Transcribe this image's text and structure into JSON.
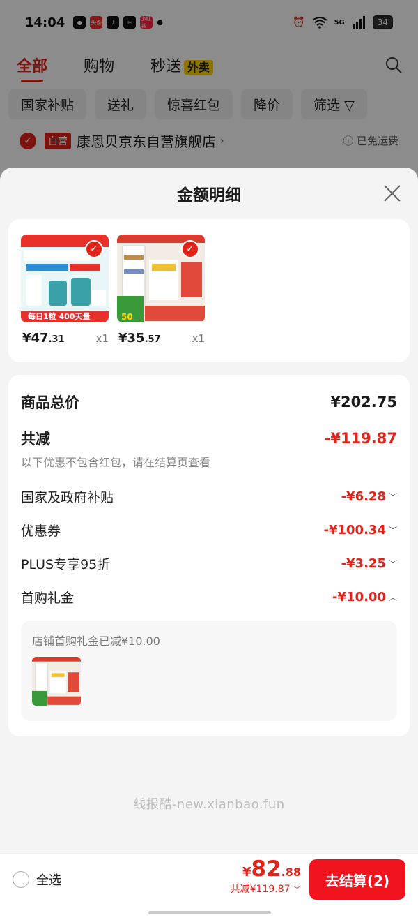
{
  "status_bar": {
    "time": "14:04",
    "app_toutiao": "头条",
    "app_xiaohongshu": "小红书",
    "network": "5G",
    "battery": "34"
  },
  "top_tabs": {
    "all": "全部",
    "shopping": "购物",
    "flash": "秒送",
    "waimai": "外卖"
  },
  "filters": [
    "国家补贴",
    "送礼",
    "惊喜红包",
    "降价",
    "筛选"
  ],
  "store": {
    "self_tag": "自营",
    "name": "康恩贝京东自营旗舰店",
    "shipping": "已免运费"
  },
  "sheet": {
    "title": "金额明细",
    "products": [
      {
        "price_int": "¥47",
        "price_dec": ".31",
        "qty": "x1"
      },
      {
        "price_int": "¥35",
        "price_dec": ".57",
        "qty": "x1"
      }
    ],
    "total_label": "商品总价",
    "total_value": "¥202.75",
    "reduce_label": "共减",
    "reduce_value": "-¥119.87",
    "reduce_note": "以下优惠不包含红包，请在结算页查看",
    "discounts": [
      {
        "label": "国家及政府补贴",
        "value": "-¥6.28",
        "expanded": false
      },
      {
        "label": "优惠券",
        "value": "-¥100.34",
        "expanded": false
      },
      {
        "label": "PLUS专享95折",
        "value": "-¥3.25",
        "expanded": false
      },
      {
        "label": "首购礼金",
        "value": "-¥10.00",
        "expanded": true
      }
    ],
    "gift_note": "店铺首购礼金已减¥10.00"
  },
  "watermark": "线报酷-new.xianbao.fun",
  "bottom_bar": {
    "select_all": "全选",
    "total_yen": "¥",
    "total_int": "82",
    "total_dec": ".88",
    "total_reduce": "共减¥119.87",
    "checkout": "去结算(2)"
  },
  "colors": {
    "accent": "#e2231a",
    "checkout": "#f1141f"
  }
}
